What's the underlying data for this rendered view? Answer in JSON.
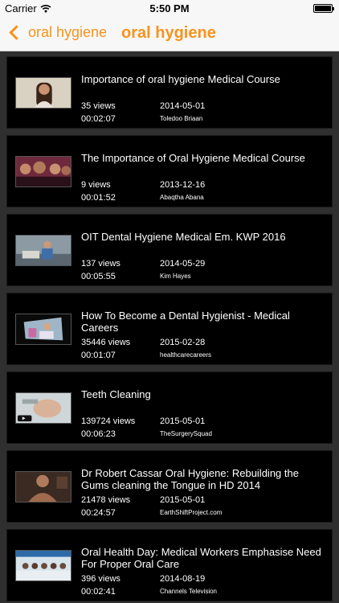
{
  "status_bar": {
    "carrier": "Carrier",
    "time": "5:50 PM"
  },
  "nav": {
    "back_label": "oral hygiene",
    "title": "oral hygiene",
    "accent_color": "#f7931e"
  },
  "videos": [
    {
      "title": "Importance of oral hygiene Medical Course",
      "views": "35 views",
      "duration": "00:02:07",
      "date": "2014-05-01",
      "channel": "Toledoo Briaan"
    },
    {
      "title": "The Importance of Oral Hygiene Medical Course",
      "views": "9 views",
      "duration": "00:01:52",
      "date": "2013-12-16",
      "channel": "Abaqtha Abana"
    },
    {
      "title": "OIT Dental Hygiene Medical Em. KWP 2016",
      "views": "137 views",
      "duration": "00:05:55",
      "date": "2014-05-29",
      "channel": "Kim Hayes"
    },
    {
      "title": "How To Become a Dental Hygienist - Medical Careers",
      "views": "35446 views",
      "duration": "00:01:07",
      "date": "2015-02-28",
      "channel": "healthcarecareers"
    },
    {
      "title": "Teeth Cleaning",
      "views": "139724 views",
      "duration": "00:06:23",
      "date": "2015-05-01",
      "channel": "TheSurgerySquad"
    },
    {
      "title": "Dr Robert Cassar Oral Hygiene: Rebuilding the Gums cleaning the Tongue in HD 2014",
      "views": "21478 views",
      "duration": "00:24:57",
      "date": "2015-05-01",
      "channel": "EarthShiftProject.com"
    },
    {
      "title": "Oral Health Day: Medical Workers Emphasise Need For Proper Oral Care",
      "views": "396 views",
      "duration": "00:02:41",
      "date": "2014-08-19",
      "channel": "Channels Television"
    }
  ]
}
